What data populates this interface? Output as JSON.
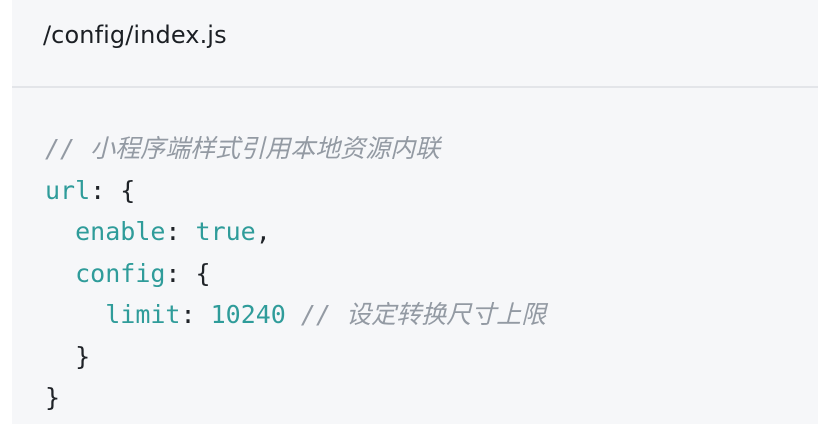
{
  "file": {
    "path": "/config/index.js"
  },
  "code": {
    "comment_1": "// 小程序端样式引用本地资源内联",
    "key_url": "url",
    "key_enable": "enable",
    "value_enable": "true",
    "key_config": "config",
    "key_limit": "limit",
    "value_limit": "10240",
    "comment_2": "// 设定转换尺寸上限"
  },
  "colors": {
    "background": "#f6f7f9",
    "header_border": "#e3e5e9",
    "keyword": "#2f9c9a",
    "comment": "#939aa3",
    "text": "#1f2328"
  }
}
